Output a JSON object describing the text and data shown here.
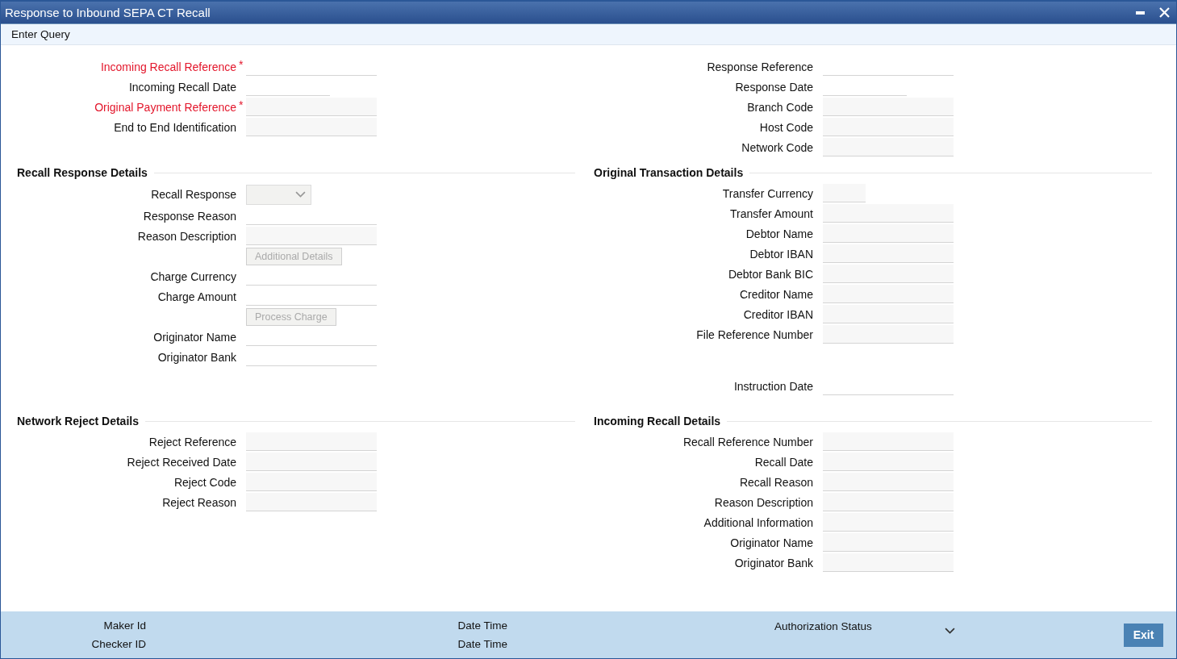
{
  "window": {
    "title": "Response to Inbound SEPA CT Recall"
  },
  "menu": [
    "Enter Query"
  ],
  "header": {
    "left": [
      {
        "label": "Incoming Recall Reference",
        "required": true,
        "required_mark": "*",
        "kind": "text"
      },
      {
        "label": "Incoming Recall Date",
        "required": false,
        "kind": "date"
      },
      {
        "label": "Original Payment Reference",
        "required": true,
        "required_mark": "*",
        "kind": "readonly"
      },
      {
        "label": "End to End Identification",
        "required": false,
        "kind": "readonly"
      }
    ],
    "right": [
      {
        "label": "Response Reference",
        "required": false,
        "kind": "text"
      },
      {
        "label": "Response Date",
        "required": false,
        "kind": "date"
      },
      {
        "label": "Branch Code",
        "required": false,
        "kind": "readonly"
      },
      {
        "label": "Host Code",
        "required": false,
        "kind": "readonly"
      },
      {
        "label": "Network Code",
        "required": false,
        "kind": "readonly"
      }
    ]
  },
  "sections": [
    [
      {
        "title": "Recall Response Details",
        "fields": [
          {
            "label": "Recall Response",
            "kind": "select"
          },
          {
            "label": "Response Reason",
            "kind": "text"
          },
          {
            "label": "Reason Description",
            "kind": "readonly"
          },
          {
            "label": "Additional Details",
            "kind": "button",
            "disabled": true
          },
          {
            "label": "Charge Currency",
            "kind": "text"
          },
          {
            "label": "Charge Amount",
            "kind": "text"
          },
          {
            "label": "Process Charge",
            "kind": "button",
            "disabled": true
          },
          {
            "label": "Originator Name",
            "kind": "text"
          },
          {
            "label": "Originator Bank",
            "kind": "text"
          }
        ]
      },
      {
        "title": "Original Transaction Details",
        "fields": [
          {
            "label": "Transfer Currency",
            "kind": "short"
          },
          {
            "label": "Transfer Amount",
            "kind": "readonly"
          },
          {
            "label": "Debtor Name",
            "kind": "readonly"
          },
          {
            "label": "Debtor IBAN",
            "kind": "readonly"
          },
          {
            "label": "Debtor Bank BIC",
            "kind": "readonly"
          },
          {
            "label": "Creditor Name",
            "kind": "readonly"
          },
          {
            "label": "Creditor IBAN",
            "kind": "readonly"
          },
          {
            "label": "File Reference Number",
            "kind": "readonly"
          },
          {
            "label": "Instruction Date",
            "kind": "separate"
          }
        ]
      }
    ],
    [
      {
        "title": "Network Reject Details",
        "fields": [
          {
            "label": "Reject Reference",
            "kind": "readonly"
          },
          {
            "label": "Reject Received Date",
            "kind": "readonly"
          },
          {
            "label": "Reject Code",
            "kind": "readonly"
          },
          {
            "label": "Reject Reason",
            "kind": "readonly"
          }
        ]
      },
      {
        "title": "Incoming Recall Details",
        "fields": [
          {
            "label": "Recall Reference Number",
            "kind": "readonly"
          },
          {
            "label": "Recall Date",
            "kind": "readonly"
          },
          {
            "label": "Recall Reason",
            "kind": "readonly"
          },
          {
            "label": "Reason Description",
            "kind": "readonly"
          },
          {
            "label": "Additional Information",
            "kind": "readonly"
          },
          {
            "label": "Originator Name",
            "kind": "readonly"
          },
          {
            "label": "Originator Bank",
            "kind": "readonly"
          }
        ]
      }
    ]
  ],
  "footer": {
    "audit": [
      [
        "Maker Id",
        "Checker ID"
      ],
      [
        "Date Time",
        "Date Time"
      ]
    ],
    "status_label": "Authorization Status",
    "exit": "Exit"
  }
}
